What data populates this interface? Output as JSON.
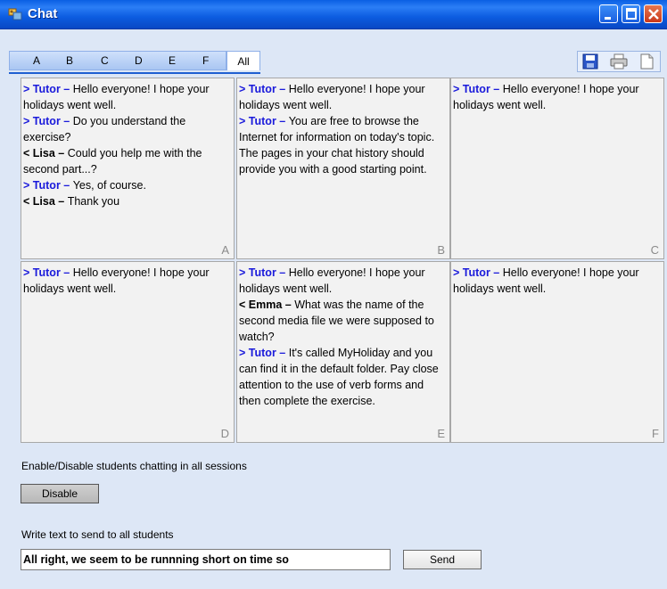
{
  "window": {
    "title": "Chat"
  },
  "tabs": [
    "A",
    "B",
    "C",
    "D",
    "E",
    "F"
  ],
  "tab_all": "All",
  "toolbar": {
    "save_icon": "save-icon",
    "print_icon": "print-icon",
    "document_icon": "document-icon"
  },
  "sessions": [
    {
      "letter": "A",
      "messages": [
        {
          "dir": ">",
          "who": "Tutor",
          "role": "tutor",
          "text": "Hello everyone! I hope your holidays went well."
        },
        {
          "dir": ">",
          "who": "Tutor",
          "role": "tutor",
          "text": "Do you understand the exercise?"
        },
        {
          "dir": "<",
          "who": "Lisa",
          "role": "student",
          "text": "Could you help me with the second part...?"
        },
        {
          "dir": ">",
          "who": "Tutor",
          "role": "tutor",
          "text": "Yes, of course."
        },
        {
          "dir": "<",
          "who": "Lisa",
          "role": "student",
          "text": "Thank you"
        }
      ]
    },
    {
      "letter": "B",
      "messages": [
        {
          "dir": ">",
          "who": "Tutor",
          "role": "tutor",
          "text": "Hello everyone! I hope your holidays went well."
        },
        {
          "dir": ">",
          "who": "Tutor",
          "role": "tutor",
          "text": "You are free to browse the Internet for information on today's topic. The pages in your chat history should provide you with a good starting point."
        }
      ]
    },
    {
      "letter": "C",
      "messages": [
        {
          "dir": ">",
          "who": "Tutor",
          "role": "tutor",
          "text": "Hello everyone! I hope your holidays went well."
        }
      ]
    },
    {
      "letter": "D",
      "messages": [
        {
          "dir": ">",
          "who": "Tutor",
          "role": "tutor",
          "text": "Hello everyone! I hope your holidays went well."
        }
      ]
    },
    {
      "letter": "E",
      "messages": [
        {
          "dir": ">",
          "who": "Tutor",
          "role": "tutor",
          "text": "Hello everyone! I hope your holidays went well."
        },
        {
          "dir": "<",
          "who": "Emma",
          "role": "student",
          "text": "What was the name of the second media file we were supposed to watch?"
        },
        {
          "dir": ">",
          "who": "Tutor",
          "role": "tutor",
          "text": "It's called MyHoliday and you can find it in the default folder. Pay close attention to the use of verb forms and then complete the exercise."
        }
      ]
    },
    {
      "letter": "F",
      "messages": [
        {
          "dir": ">",
          "who": "Tutor",
          "role": "tutor",
          "text": "Hello everyone! I hope your holidays went well."
        }
      ]
    }
  ],
  "controls": {
    "enable_label": "Enable/Disable students chatting in all sessions",
    "disable_button": "Disable",
    "write_label": "Write text to send to all students",
    "message_value": "All right, we seem to be runnning short on time so",
    "send_button": "Send"
  }
}
